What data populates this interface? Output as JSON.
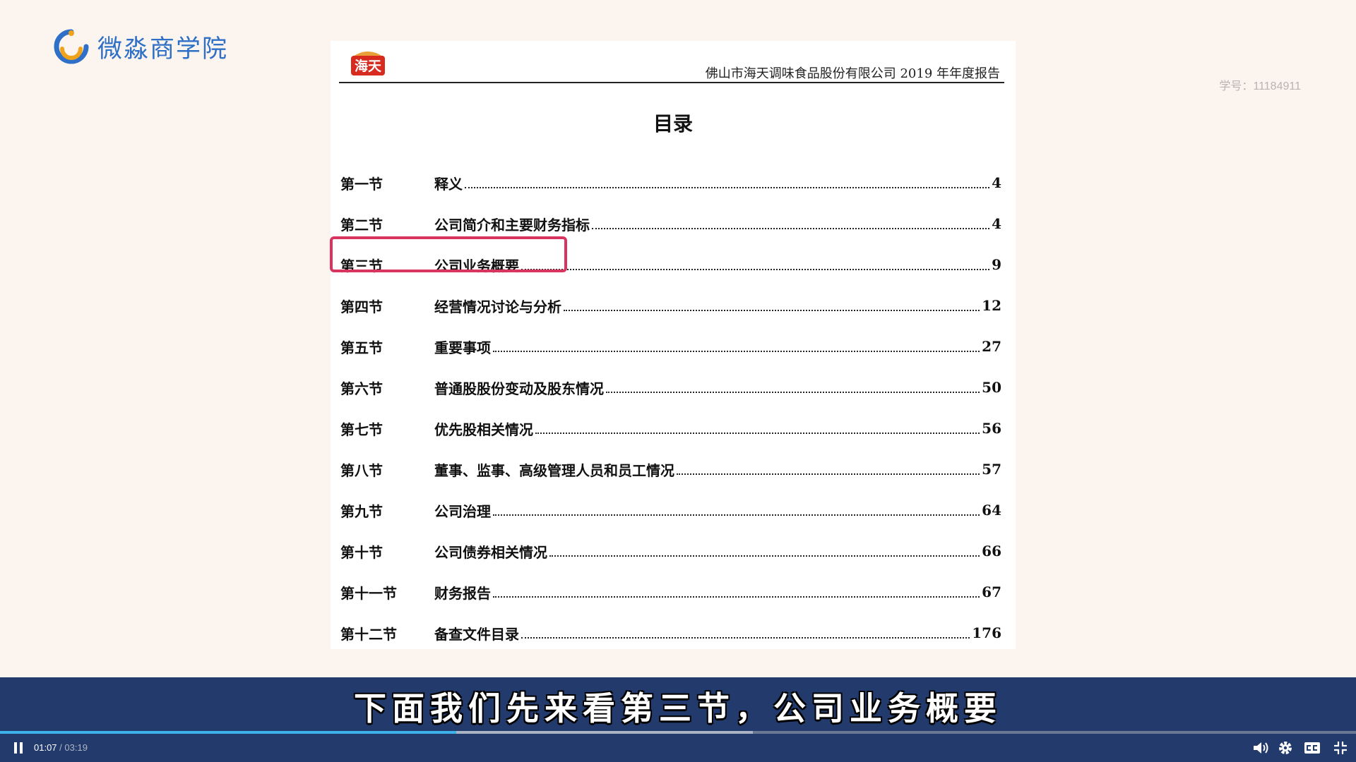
{
  "brand": {
    "name": "微淼商学院",
    "colors": {
      "primary": "#2e6fc7",
      "accent": "#f0a21b"
    }
  },
  "watermark": "学号：11184911",
  "document": {
    "logo_text": "海天",
    "header": "佛山市海天调味食品股份有限公司 2019 年年度报告",
    "title": "目录",
    "toc": [
      {
        "section": "第一节",
        "title": "释义",
        "page": "4"
      },
      {
        "section": "第二节",
        "title": "公司简介和主要财务指标",
        "page": "4"
      },
      {
        "section": "第三节",
        "title": "公司业务概要",
        "page": "9"
      },
      {
        "section": "第四节",
        "title": "经营情况讨论与分析",
        "page": "12"
      },
      {
        "section": "第五节",
        "title": "重要事项",
        "page": "27"
      },
      {
        "section": "第六节",
        "title": "普通股股份变动及股东情况",
        "page": "50"
      },
      {
        "section": "第七节",
        "title": "优先股相关情况",
        "page": "56"
      },
      {
        "section": "第八节",
        "title": "董事、监事、高级管理人员和员工情况",
        "page": "57"
      },
      {
        "section": "第九节",
        "title": "公司治理",
        "page": "64"
      },
      {
        "section": "第十节",
        "title": "公司债券相关情况",
        "page": "66"
      },
      {
        "section": "第十一节",
        "title": "财务报告",
        "page": "67"
      },
      {
        "section": "第十二节",
        "title": "备查文件目录",
        "page": "176"
      }
    ],
    "highlight_color": "#d8345f"
  },
  "video": {
    "subtitle": "下面我们先来看第三节，公司业务概要",
    "current_time": "01:07",
    "time_separator": "/",
    "duration": "03:19",
    "progress": 0.3367,
    "buffered": 0.555,
    "icons": [
      "pause-icon",
      "volume-icon",
      "settings-icon",
      "captions-icon",
      "exit-fullscreen-icon"
    ],
    "colors": {
      "bar": "#233b6c",
      "progress": "#3fb1ea"
    }
  }
}
